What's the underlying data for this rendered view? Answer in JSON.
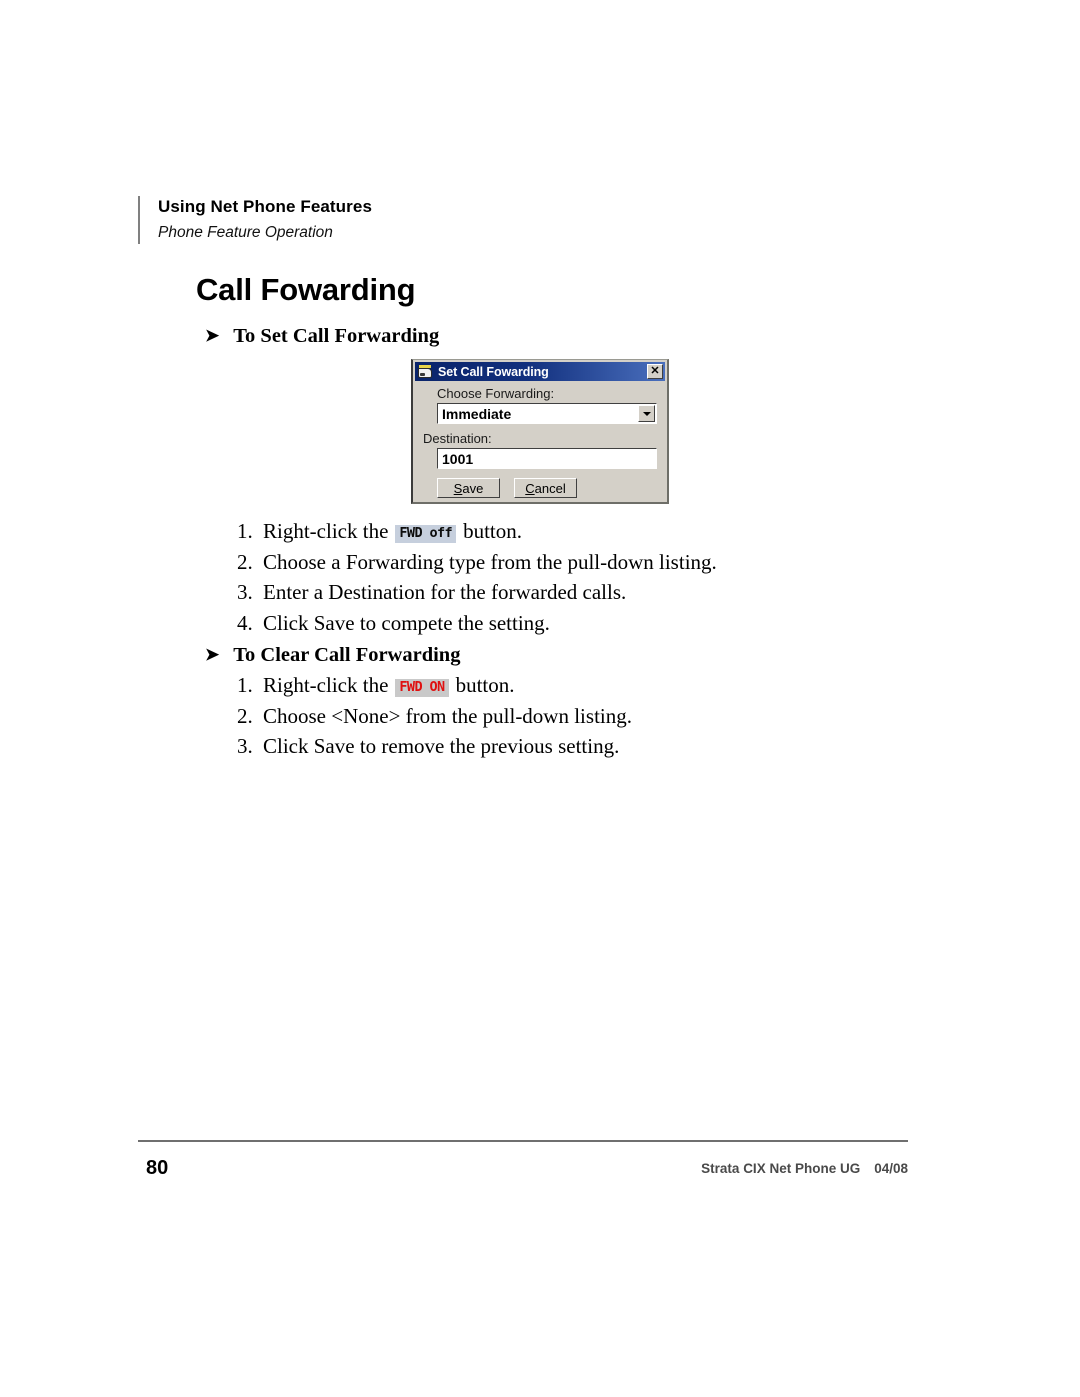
{
  "header": {
    "title": "Using Net Phone Features",
    "subtitle": "Phone Feature Operation"
  },
  "chapter_title": "Call Fowarding",
  "sections": [
    {
      "heading": "To Set Call Forwarding",
      "arrow_icon": "right-triangle-bullet-icon",
      "steps": [
        {
          "num": "1.",
          "before": "Right-click the",
          "badge": "FWD off",
          "after": "button."
        },
        {
          "num": "2.",
          "before": "Choose a Forwarding type from the pull-down listing.",
          "badge": "",
          "after": ""
        },
        {
          "num": "3.",
          "before": "Enter a Destination for the forwarded calls.",
          "badge": "",
          "after": ""
        },
        {
          "num": "4.",
          "before": "Click Save to compete the setting.",
          "badge": "",
          "after": ""
        }
      ]
    },
    {
      "heading": "To Clear Call Forwarding",
      "arrow_icon": "right-triangle-bullet-icon",
      "steps": [
        {
          "num": "1.",
          "before": "Right-click the",
          "badge": "FWD ON",
          "after": "button."
        },
        {
          "num": "2.",
          "before": "Choose <None> from the pull-down listing.",
          "badge": "",
          "after": ""
        },
        {
          "num": "3.",
          "before": "Click Save to remove the previous setting.",
          "badge": "",
          "after": ""
        }
      ]
    }
  ],
  "dialog": {
    "title": "Set Call Fowarding",
    "title_icon": "phone-app-icon",
    "close_label": "✕",
    "forwarding_label": "Choose Forwarding:",
    "forwarding_value": "Immediate",
    "destination_label": "Destination:",
    "destination_value": "1001",
    "save_label_mnemonic": "S",
    "save_label_rest": "ave",
    "cancel_label_mnemonic": "C",
    "cancel_label_rest": "ancel",
    "titlebar_color": "#0a246a",
    "face_color": "#d4d0c8"
  },
  "badges": {
    "fwd_off_bg": "#c6cfdd",
    "fwd_on_bg": "#c9c9c9",
    "fwd_on_fg": "#e01010"
  },
  "footer": {
    "page_number": "80",
    "document_name": "Strata CIX Net Phone UG",
    "date": "04/08"
  }
}
